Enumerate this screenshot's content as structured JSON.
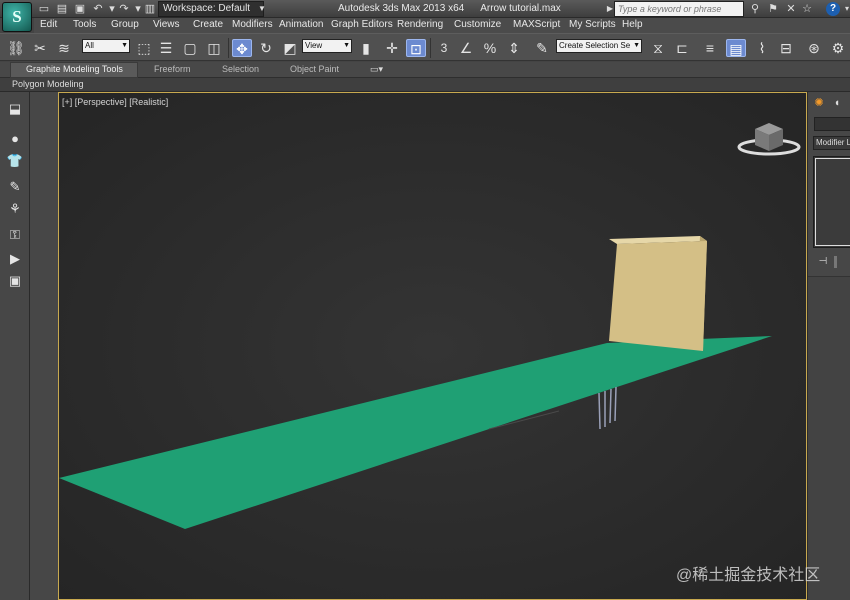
{
  "window": {
    "app_title": "Autodesk 3ds Max  2013 x64",
    "file_name": "Arrow tutorial.max",
    "workspace_value": "Workspace: Default",
    "search_placeholder": "Type a keyword or phrase"
  },
  "menu": {
    "items": [
      "Edit",
      "Tools",
      "Group",
      "Views",
      "Create",
      "Modifiers",
      "Animation",
      "Graph Editors",
      "Rendering",
      "Customize",
      "MAXScript",
      "My Scripts",
      "Help"
    ]
  },
  "toolbar": {
    "selection_filter": "All",
    "reference_coord": "View",
    "named_selection": "Create Selection Se",
    "snap_value": "3"
  },
  "ribbon": {
    "tabs": [
      "Graphite Modeling Tools",
      "Freeform",
      "Selection",
      "Object Paint"
    ],
    "panel_label": "Polygon Modeling"
  },
  "viewport": {
    "label": "[+] [Perspective] [Realistic]",
    "background_color": "#2b2b2b",
    "plane_color": "#1fa074",
    "box_color": "#d4bf86",
    "border_color": "#c8a94f"
  },
  "command_panel": {
    "modifier_list_label": "Modifier Li"
  },
  "watermark": "@稀土掘金技术社区"
}
